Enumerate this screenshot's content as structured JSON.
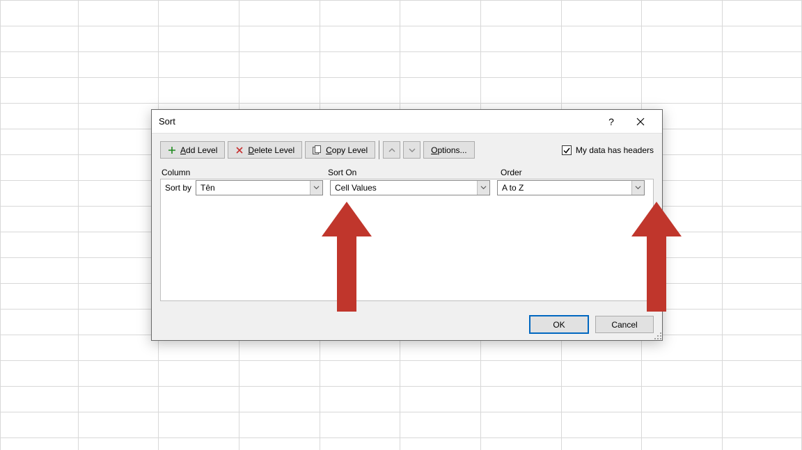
{
  "dialog": {
    "title": "Sort",
    "toolbar": {
      "add_level_prefix": "A",
      "add_level_rest": "dd Level",
      "delete_level_prefix": "D",
      "delete_level_rest": "elete Level",
      "copy_level_prefix": "C",
      "copy_level_rest": "opy Level",
      "options_prefix": "O",
      "options_rest": "ptions...",
      "headers_prefix": "My data has ",
      "headers_underlined": "h",
      "headers_rest": "eaders"
    },
    "columns": {
      "column_label": "Column",
      "sort_on_label": "Sort On",
      "order_label": "Order"
    },
    "rule": {
      "sort_by_label": "Sort by",
      "column_value": "Tên",
      "sort_on_value": "Cell Values",
      "order_value": "A to Z"
    },
    "buttons": {
      "ok": "OK",
      "cancel": "Cancel"
    },
    "checkbox_checked": true
  }
}
